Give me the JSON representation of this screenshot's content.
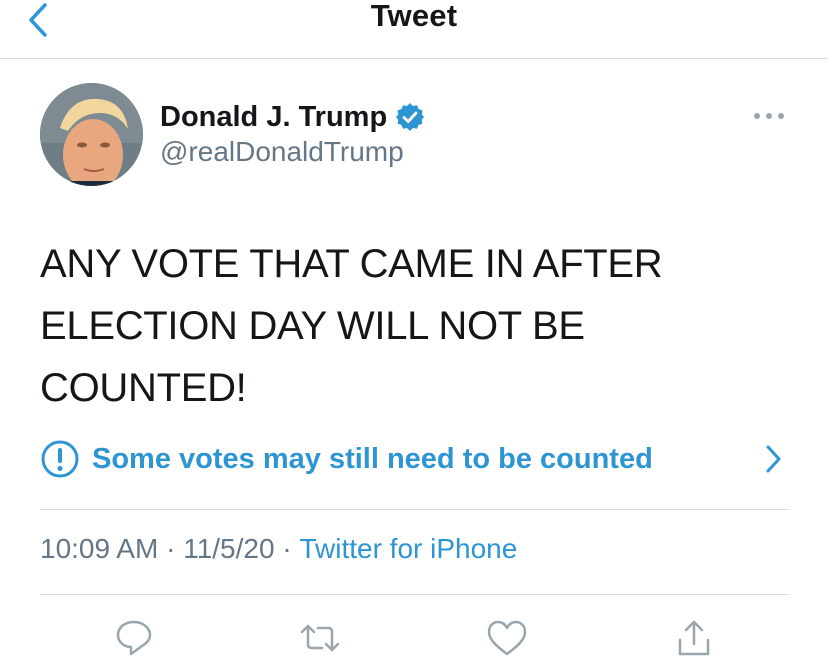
{
  "header": {
    "title": "Tweet",
    "back_icon": "chevron-left-icon"
  },
  "author": {
    "display_name": "Donald J. Trump",
    "handle": "@realDonaldTrump",
    "verified_icon": "verified-badge-icon"
  },
  "tweet": {
    "text_lines": [
      "ANY VOTE THAT CAME IN AFTER",
      "ELECTION DAY WILL NOT BE",
      "COUNTED!"
    ]
  },
  "notice": {
    "text": "Some votes may still need to be counted",
    "icon": "exclamation-circle-icon",
    "chevron_icon": "chevron-right-icon"
  },
  "meta": {
    "time": "10:09 AM",
    "separator": " · ",
    "date": "11/5/20",
    "source": "Twitter for iPhone"
  },
  "actions": [
    "reply-icon",
    "retweet-icon",
    "like-icon",
    "share-icon"
  ],
  "colors": {
    "accent": "#2e95d3",
    "secondary_text": "#657786",
    "divider": "#d9dde0"
  }
}
